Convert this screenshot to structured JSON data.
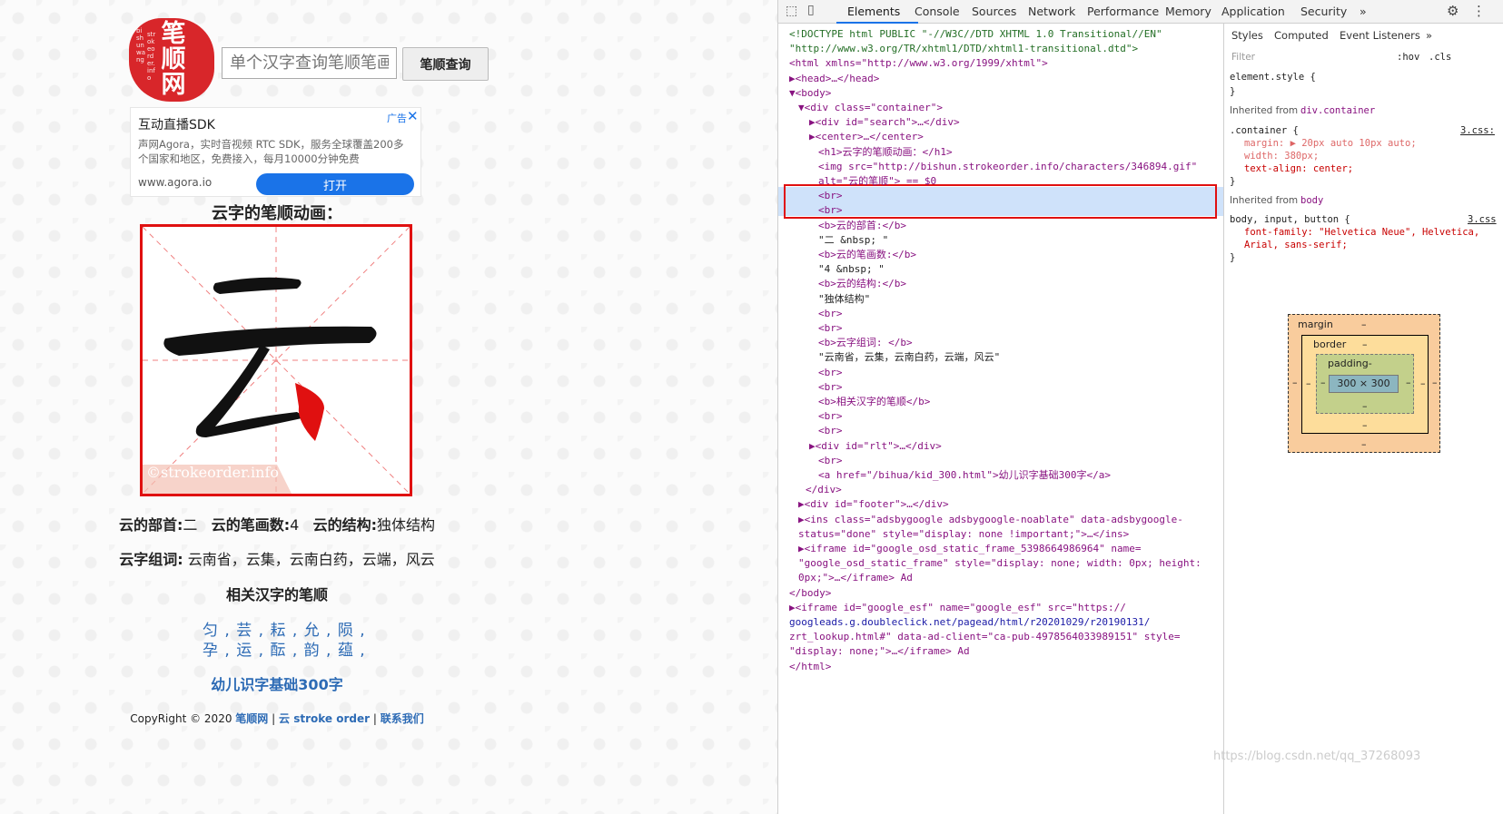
{
  "page": {
    "logo": {
      "big": "笔顺网",
      "side": "bi shun wang",
      "side2": "strokeorder.info"
    },
    "search": {
      "placeholder": "单个汉字查询笔顺笔画",
      "button": "笔顺查询"
    },
    "ad": {
      "title": "互动直播SDK",
      "desc": "声网Agora，实时音视频 RTC SDK，服务全球覆盖200多个国家和地区，免费接入，每月10000分钟免费",
      "url": "www.agora.io",
      "open": "打开",
      "badge": "广告",
      "close": "✕"
    },
    "char_title": "云字的笔顺动画：",
    "char": "云",
    "watermark": "©strokeorder.info",
    "info1": {
      "k1": "云的部首:",
      "v1": "二",
      "k2": "云的笔画数:",
      "v2": "4",
      "k3": "云的结构:",
      "v3": "独体结构"
    },
    "info2": {
      "k": "云字组词:",
      "v": "云南省，云集，云南白药，云端，风云"
    },
    "related_title": "相关汉字的笔顺",
    "related_row1": [
      "匀",
      "芸",
      "耘",
      "允",
      "陨"
    ],
    "related_row2": [
      "孕",
      "运",
      "酝",
      "韵",
      "蕴"
    ],
    "kid_link": "幼儿识字基础300字",
    "footer": {
      "prefix": "CopyRight © 2020",
      "site": "笔顺网",
      "sep": "|",
      "link": "云 stroke order",
      "contact": "联系我们"
    }
  },
  "devtools": {
    "tabs": [
      "Elements",
      "Console",
      "Sources",
      "Network",
      "Performance",
      "Memory",
      "Application",
      "Security",
      "»"
    ],
    "dom": [
      {
        "t": "<!DOCTYPE html PUBLIC \"-//W3C//DTD XHTML 1.0 Transitional//EN\"",
        "c": "cm"
      },
      {
        "t": "\"http://www.w3.org/TR/xhtml1/DTD/xhtml1-transitional.dtd\">",
        "c": "cm"
      },
      {
        "t": "<html xmlns=\"http://www.w3.org/1999/xhtml\">",
        "c": "tg"
      },
      {
        "t": "▶<head>…</head>",
        "c": "tg"
      },
      {
        "t": "▼<body>",
        "c": "tg"
      },
      {
        "t": "▼<div class=\"container\">",
        "c": "tg"
      },
      {
        "t": "▶<div id=\"search\">…</div>",
        "c": "tg"
      },
      {
        "t": "▶<center>…</center>",
        "c": "tg"
      },
      {
        "t": "<h1>云字的笔顺动画：</h1>",
        "c": "tg"
      },
      {
        "t": "<img src=\"http://bishun.strokeorder.info/characters/346894.gif\"",
        "c": "tg"
      },
      {
        "t": "alt=\"云的笔顺\"> == $0",
        "c": "tg"
      },
      {
        "t": "<br>",
        "c": "tg"
      },
      {
        "t": "<br>",
        "c": "tg"
      },
      {
        "t": "<b>云的部首:</b>",
        "c": "tg"
      },
      {
        "t": "\"二 &nbsp;   \"",
        "c": "tx"
      },
      {
        "t": "<b>云的笔画数:</b>",
        "c": "tg"
      },
      {
        "t": "\"4 &nbsp;   \"",
        "c": "tx"
      },
      {
        "t": "<b>云的结构:</b>",
        "c": "tg"
      },
      {
        "t": "\"独体结构\"",
        "c": "tx"
      },
      {
        "t": "<br>",
        "c": "tg"
      },
      {
        "t": "<br>",
        "c": "tg"
      },
      {
        "t": "<b>云字组词: </b>",
        "c": "tg"
      },
      {
        "t": "\"云南省，云集，云南白药，云端，风云\"",
        "c": "tx"
      },
      {
        "t": "<br>",
        "c": "tg"
      },
      {
        "t": "<br>",
        "c": "tg"
      },
      {
        "t": "<b>相关汉字的笔顺</b>",
        "c": "tg"
      },
      {
        "t": "<br>",
        "c": "tg"
      },
      {
        "t": "<br>",
        "c": "tg"
      },
      {
        "t": "▶<div id=\"rlt\">…</div>",
        "c": "tg"
      },
      {
        "t": "<br>",
        "c": "tg"
      },
      {
        "t": "<a href=\"/bihua/kid_300.html\">幼儿识字基础300字</a>",
        "c": "tg"
      },
      {
        "t": "</div>",
        "c": "tg"
      },
      {
        "t": "▶<div id=\"footer\">…</div>",
        "c": "tg"
      },
      {
        "t": "▶<ins class=\"adsbygoogle adsbygoogle-noablate\" data-adsbygoogle-",
        "c": "tg"
      },
      {
        "t": "status=\"done\" style=\"display: none !important;\">…</ins>",
        "c": "tg"
      },
      {
        "t": "▶<iframe id=\"google_osd_static_frame_5398664986964\" name=",
        "c": "tg"
      },
      {
        "t": "\"google_osd_static_frame\" style=\"display: none; width: 0px; height:",
        "c": "tg"
      },
      {
        "t": "0px;\">…</iframe> Ad",
        "c": "tg"
      },
      {
        "t": "</body>",
        "c": "tg"
      },
      {
        "t": "▶<iframe id=\"google_esf\" name=\"google_esf\" src=\"https://",
        "c": "tg"
      },
      {
        "t": "googleads.g.doubleclick.net/pagead/html/r20201029/r20190131/",
        "c": "av"
      },
      {
        "t": "zrt_lookup.html#\" data-ad-client=\"ca-pub-4978564033989151\" style=",
        "c": "tg"
      },
      {
        "t": "\"display: none;\">…</iframe> Ad",
        "c": "tg"
      },
      {
        "t": "</html>",
        "c": "tg"
      }
    ],
    "styles": {
      "subtabs": [
        "Styles",
        "Computed",
        "Event Listeners",
        "»"
      ],
      "filter": "Filter",
      "hov": ":hov",
      "cls": ".cls",
      "element_style": "element.style {",
      "close": "}",
      "inherit1": "Inherited from",
      "inherit1_el": "div.container",
      "rule1_sel": ".container {",
      "rule1_src": "3.css:",
      "rule1_props": [
        "margin: ▶ 20px auto 10px auto;",
        "width: 380px;",
        "text-align: center;"
      ],
      "inherit2": "Inherited from",
      "inherit2_el": "body",
      "rule2_sel": "body, input, button {",
      "rule2_src": "3.css",
      "rule2_props": [
        "font-family: \"Helvetica Neue\", Helvetica,",
        "    Arial, sans-serif;"
      ],
      "box": {
        "margin": "margin",
        "border": "border",
        "padding": "padding-",
        "content": "300 × 300",
        "dash": "–"
      }
    }
  },
  "watermark": "https://blog.csdn.net/qq_37268093"
}
